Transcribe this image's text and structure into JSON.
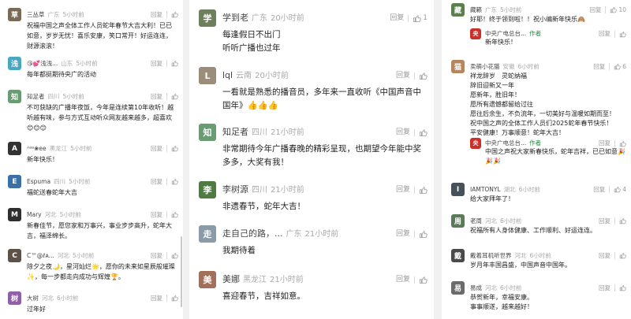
{
  "labels": {
    "reply": "回复",
    "author": "作者"
  },
  "left": [
    {
      "user": "三丛草",
      "loc": "广东",
      "time": "5小时前",
      "likes": "",
      "avatar_char": "草",
      "avatar_color": "#7a6a55",
      "text": "祝福中国之声全体工作人员蛇年春节大吉大利！已已如意，岁岁无忧！喜乐安康，笑口常开！好运连连，财源滚滚！"
    },
    {
      "user": "😘💕浅浅...",
      "loc": "山东",
      "time": "5小时前",
      "likes": "",
      "avatar_char": "浅",
      "avatar_color": "#4aa7c4",
      "text": "每年都挺期待央广的活动"
    },
    {
      "user": "知足者",
      "loc": "四川",
      "time": "5小时前",
      "likes": "",
      "avatar_char": "知",
      "avatar_color": "#6a9c73",
      "text": "不可获缺的广播年夜饭，今年是连续第10年收听！越听越有味，参与方式互动听众网友越来越多，超喜欢😊😊😊"
    },
    {
      "user": "ᴬᵃᵃ❀ee",
      "loc": "黑龙江",
      "time": "5小时前",
      "likes": "",
      "avatar_char": "A",
      "avatar_color": "#333333",
      "text": "新年快乐！"
    },
    {
      "user": "Espuma",
      "loc": "四川",
      "time": "5小时前",
      "likes": "",
      "avatar_char": "E",
      "avatar_color": "#3b6fa8",
      "text": "福蛇送春蛇年大吉"
    },
    {
      "user": "Mary",
      "loc": "河北",
      "time": "5小时前",
      "likes": "",
      "avatar_char": "M",
      "avatar_color": "#2f2f2f",
      "text": "新春佳节，愿您家和万事兴，事业步步高升，蛇年大吉，福泽绵长。"
    },
    {
      "user": "C™@ℓᴀ...",
      "loc": "河北",
      "time": "5小时前",
      "likes": "",
      "avatar_char": "C",
      "avatar_color": "#5c5248",
      "text": "除夕之夜🌙，星河灿烂🌟，愿你的未来如星辰般璀璨✨，每一步都走向成功与辉煌🏆。"
    },
    {
      "user": "大树",
      "loc": "河北",
      "time": "6小时前",
      "likes": "",
      "avatar_char": "树",
      "avatar_color": "#8f5fa8",
      "text": "过年好"
    }
  ],
  "middle": [
    {
      "user": "学到老",
      "loc": "广东",
      "time": "20小时前",
      "likes": "1",
      "avatar_char": "学",
      "avatar_color": "#6e7f5c",
      "text": "每逢假日不出门\n听听广播也过年"
    },
    {
      "user": "lql",
      "loc": "云南",
      "time": "20小时前",
      "likes": "",
      "avatar_char": "L",
      "avatar_color": "#9c8c7a",
      "text": "一看就是熟悉的播音员，多年来一直收听《中国声音中国年》👍👍👍"
    },
    {
      "user": "知足者",
      "loc": "四川",
      "time": "21小时前",
      "likes": "",
      "avatar_char": "知",
      "avatar_color": "#6a9c73",
      "text": "非常期待今年广播春晚的精彩呈现，也期望今年能中奖多多，大奖有我！"
    },
    {
      "user": "李树源",
      "loc": "四川",
      "time": "21小时前",
      "likes": "",
      "avatar_char": "李",
      "avatar_color": "#4f7a44",
      "text": "非遗春节，蛇年大吉！"
    },
    {
      "user": "走自己的路，...",
      "loc": "广东",
      "time": "21小时前",
      "likes": "",
      "avatar_char": "走",
      "avatar_color": "#8a9aa6",
      "text": "我期待着"
    },
    {
      "user": "美娜",
      "loc": "黑龙江",
      "time": "21小时前",
      "likes": "",
      "avatar_char": "美",
      "avatar_color": "#a0705a",
      "text": "喜迎春节，吉祥如意。"
    }
  ],
  "right": [
    {
      "user": "藏籁",
      "loc": "广东",
      "time": "5小时前",
      "likes": "10",
      "avatar_char": "藏",
      "avatar_color": "#5d7f4e",
      "sub": false,
      "text": "好耶！终于领到啦！！祝小编新年快乐🙈"
    },
    {
      "user": "中央广电总台...",
      "loc": "",
      "time": "",
      "likes": "",
      "avatar_char": "央",
      "avatar_color": "#c9302c",
      "sub": true,
      "author": true,
      "text": "新年快乐！"
    },
    {
      "user": "卖萌小花猫",
      "loc": "安徽",
      "time": "6小时前",
      "likes": "6",
      "avatar_char": "猫",
      "avatar_color": "#b7855c",
      "sub": false,
      "text": "祥龙辞岁　灵蛇纳福\n辞旧迎新又一年\n愿新年，胜旧年！\n愿所有遗憾都留给过往\n愿往后余生，不负流年，一切美好与温暖如期而至！\n祝中国之声的全体工作人员们2025蛇年春节快乐！\n平安健康！万事顺意！蛇年大吉！"
    },
    {
      "user": "中央广电总台...",
      "loc": "",
      "time": "",
      "likes": "",
      "avatar_char": "央",
      "avatar_color": "#c9302c",
      "sub": true,
      "author": true,
      "text": "中国之声祝大家新春快乐，蛇年吉祥，已已如意🎉🎉🎉"
    },
    {
      "user": "IAMTONYL",
      "loc": "湖北",
      "time": "6小时前",
      "likes": "4",
      "avatar_char": "I",
      "avatar_color": "#46505a",
      "sub": false,
      "text": "给大家拜年了！"
    },
    {
      "user": "老周",
      "loc": "河北",
      "time": "6小时前",
      "likes": "",
      "avatar_char": "周",
      "avatar_color": "#5c7a5a",
      "sub": false,
      "text": "祝福所有人身体健康、工作顺利、好运连连。"
    },
    {
      "user": "戴着耳机听世界",
      "loc": "河北",
      "time": "6小时前",
      "likes": "",
      "avatar_char": "戴",
      "avatar_color": "#4a4a4a",
      "sub": false,
      "text": "岁月年丰国昌盛，中国声音中国年。"
    },
    {
      "user": "易成",
      "loc": "河北",
      "time": "6小时前",
      "likes": "",
      "avatar_char": "易",
      "avatar_color": "#6b6b6b",
      "sub": false,
      "text": "恭贺新年，幸福安康。\n事事顺遂，越来越好！"
    }
  ]
}
